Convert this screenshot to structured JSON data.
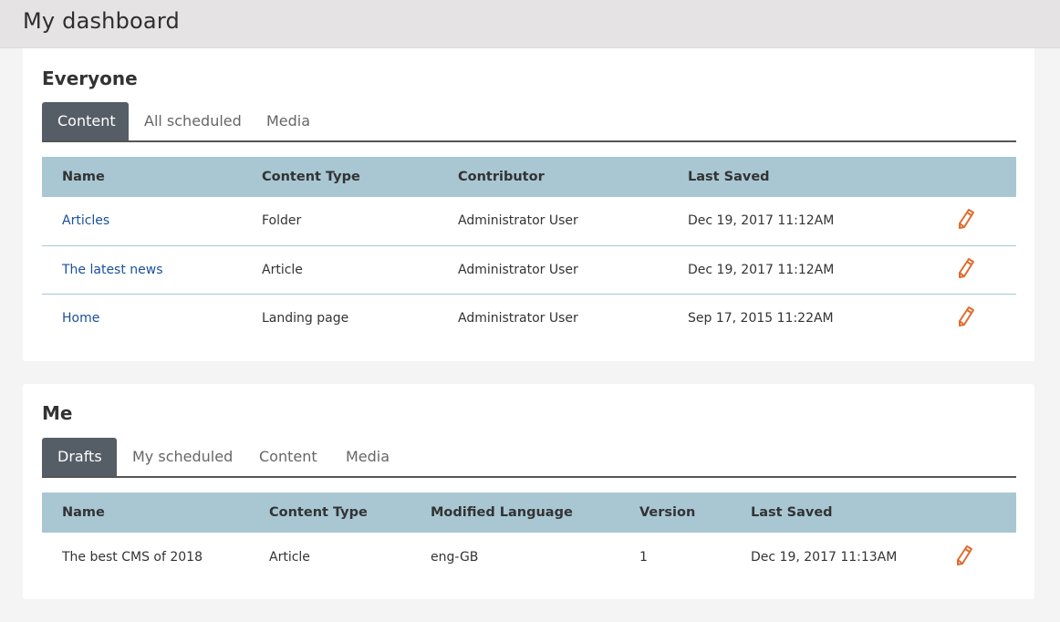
{
  "header": {
    "title": "My dashboard"
  },
  "everyone": {
    "title": "Everyone",
    "tabs": [
      {
        "label": "Content"
      },
      {
        "label": "All scheduled"
      },
      {
        "label": "Media"
      }
    ],
    "columns": [
      "Name",
      "Content Type",
      "Contributor",
      "Last Saved"
    ],
    "rows": [
      {
        "name": "Articles",
        "type": "Folder",
        "contributor": "Administrator User",
        "saved": "Dec 19, 2017 11:12AM"
      },
      {
        "name": "The latest news",
        "type": "Article",
        "contributor": "Administrator User",
        "saved": "Dec 19, 2017 11:12AM"
      },
      {
        "name": "Home",
        "type": "Landing page",
        "contributor": "Administrator User",
        "saved": "Sep 17, 2015 11:22AM"
      }
    ]
  },
  "me": {
    "title": "Me",
    "tabs": [
      {
        "label": "Drafts"
      },
      {
        "label": "My scheduled"
      },
      {
        "label": "Content"
      },
      {
        "label": "Media"
      }
    ],
    "columns": [
      "Name",
      "Content Type",
      "Modified Language",
      "Version",
      "Last Saved"
    ],
    "rows": [
      {
        "name": "The best CMS of 2018",
        "type": "Article",
        "language": "eng-GB",
        "version": "1",
        "saved": "Dec 19, 2017 11:13AM"
      }
    ]
  },
  "icons": {
    "edit": "pencil-icon"
  },
  "colors": {
    "accent": "#e06b2d",
    "header_bg": "#a8c7d3",
    "tab_active": "#555d66",
    "link": "#1a4f9c"
  }
}
